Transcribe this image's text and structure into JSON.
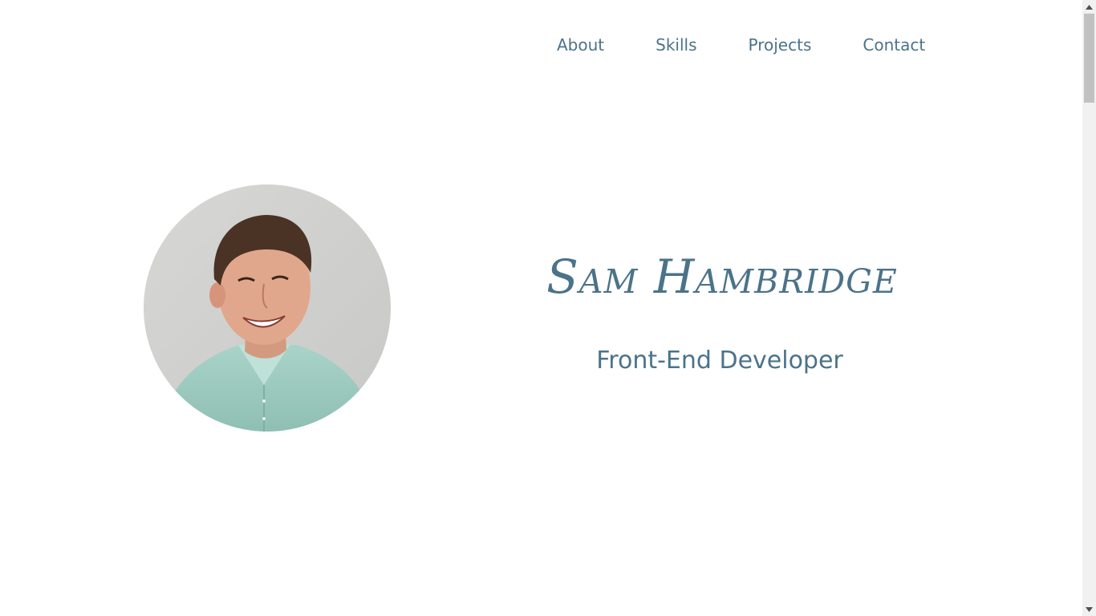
{
  "nav": {
    "items": [
      {
        "label": "About"
      },
      {
        "label": "Skills"
      },
      {
        "label": "Projects"
      },
      {
        "label": "Contact"
      }
    ]
  },
  "hero": {
    "name": "Sam Hambridge",
    "role": "Front-End Developer"
  },
  "colors": {
    "accent": "#4b7389",
    "background": "#ffffff",
    "scrollbar_track": "#f1f1f1",
    "scrollbar_thumb": "#c1c1c1"
  },
  "icons": {
    "scroll_up": "triangle-up-icon",
    "scroll_down": "triangle-down-icon"
  }
}
